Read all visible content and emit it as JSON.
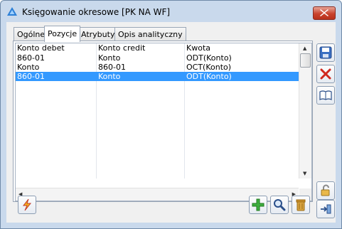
{
  "window": {
    "title": "Księgowanie okresowe [PK NA WF]"
  },
  "tabs": [
    {
      "label": "Ogólne"
    },
    {
      "label": "Pozycje"
    },
    {
      "label": "Atrybuty"
    },
    {
      "label": "Opis analityczny"
    }
  ],
  "active_tab": "Pozycje",
  "grid": {
    "columns": [
      "Konto debet",
      "Konto credit",
      "Kwota"
    ],
    "rows": [
      [
        "860-01",
        "Konto",
        "ODT(Konto)"
      ],
      [
        "Konto",
        "860-01",
        "OCT(Konto)"
      ],
      [
        "860-01",
        "Konto",
        "ODT(Konto)"
      ]
    ],
    "selected_row": 3
  },
  "icons": {
    "app": "app-triangle-icon",
    "close": "close-x-icon",
    "save": "floppy-disk-icon",
    "cancel": "red-x-icon",
    "help": "open-book-icon",
    "lock": "padlock-icon",
    "exit": "exit-door-icon",
    "generate": "lightning-icon",
    "add": "green-plus-icon",
    "preview": "magnifier-icon",
    "delete": "trash-bin-icon"
  },
  "colors": {
    "titlebar": "#c9d9ec",
    "selection": "#3399ff",
    "close": "#c9432d"
  }
}
